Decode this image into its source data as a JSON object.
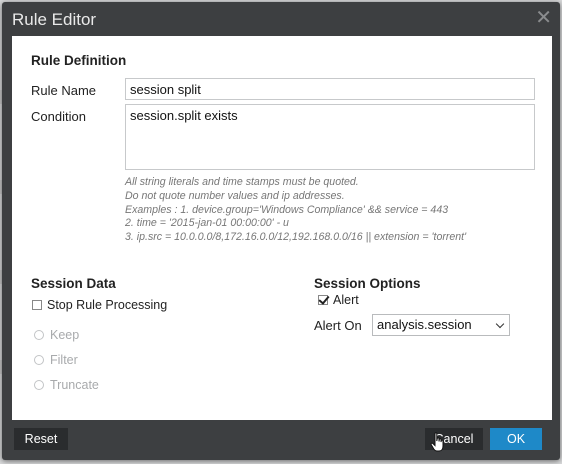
{
  "dialog": {
    "title": "Rule Editor",
    "close_glyph": "✕"
  },
  "rule_definition": {
    "heading": "Rule Definition",
    "rule_name_label": "Rule Name",
    "rule_name_value": "session split",
    "condition_label": "Condition",
    "condition_value": "session.split exists",
    "hints": [
      "All string literals and time stamps must be quoted.",
      "Do not quote number values and ip addresses.",
      "Examples : 1. device.group='Windows Compliance' && service = 443",
      "2. time = '2015-jan-01 00:00:00' - u",
      "3. ip.src = 10.0.0.0/8,172.16.0.0/12,192.168.0.0/16 || extension = 'torrent'"
    ]
  },
  "session_data": {
    "heading": "Session Data",
    "stop_rule_label": "Stop Rule Processing",
    "stop_rule_checked": false,
    "options": [
      "Keep",
      "Filter",
      "Truncate"
    ]
  },
  "session_options": {
    "heading": "Session Options",
    "alert_label": "Alert",
    "alert_checked": true,
    "alert_on_label": "Alert On",
    "alert_on_value": "analysis.session"
  },
  "footer": {
    "reset_label": "Reset",
    "cancel_label": "Cancel",
    "ok_label": "OK"
  },
  "colors": {
    "dialog_chrome": "#3d3f41",
    "ok_button": "#1e89c8",
    "dark_button": "#2a2c2e"
  },
  "icons": {
    "close": "close-icon",
    "checkbox_checked": "checkmark-icon",
    "select": "chevron-down-icon",
    "cursor": "hand-pointer-icon"
  }
}
